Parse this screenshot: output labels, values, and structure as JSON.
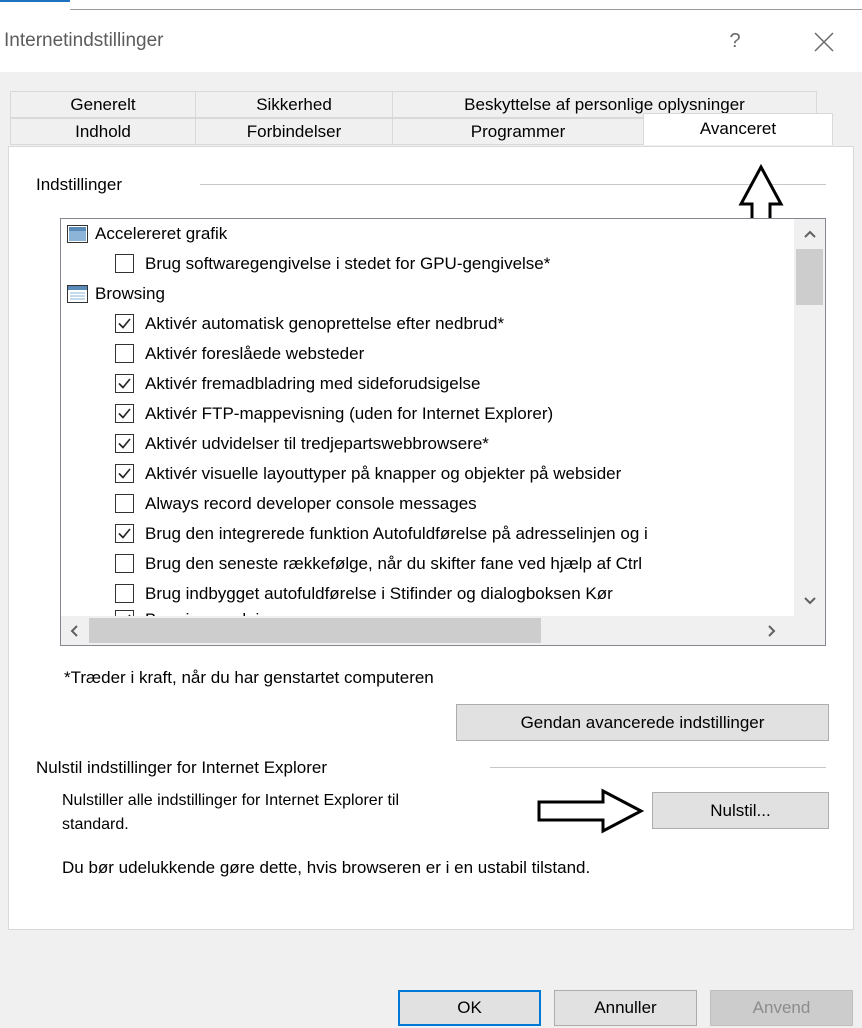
{
  "window": {
    "title": "Internetindstillinger",
    "help_glyph": "?"
  },
  "tabs": {
    "row1": [
      {
        "label": "Generelt"
      },
      {
        "label": "Sikkerhed"
      },
      {
        "label": "Beskyttelse af personlige oplysninger"
      }
    ],
    "row2": [
      {
        "label": "Indhold"
      },
      {
        "label": "Forbindelser"
      },
      {
        "label": "Programmer"
      },
      {
        "label": "Avanceret",
        "active": true
      }
    ]
  },
  "settings": {
    "group_label": "Indstillinger",
    "items": [
      {
        "kind": "category",
        "label": "Accelereret grafik",
        "icon": "display-category-icon"
      },
      {
        "kind": "checkbox",
        "checked": false,
        "label": "Brug softwaregengivelse i stedet for GPU-gengivelse*"
      },
      {
        "kind": "category",
        "label": "Browsing",
        "icon": "window-category-icon"
      },
      {
        "kind": "checkbox",
        "checked": true,
        "label": "Aktivér automatisk genoprettelse efter nedbrud*"
      },
      {
        "kind": "checkbox",
        "checked": false,
        "label": "Aktivér foreslåede websteder"
      },
      {
        "kind": "checkbox",
        "checked": true,
        "label": "Aktivér fremadbladring med sideforudsigelse"
      },
      {
        "kind": "checkbox",
        "checked": true,
        "label": "Aktivér FTP-mappevisning (uden for Internet Explorer)"
      },
      {
        "kind": "checkbox",
        "checked": true,
        "label": "Aktivér udvidelser til tredjepartswebbrowsere*"
      },
      {
        "kind": "checkbox",
        "checked": true,
        "label": "Aktivér visuelle layouttyper på knapper og objekter på websider"
      },
      {
        "kind": "checkbox",
        "checked": false,
        "label": "Always record developer console messages"
      },
      {
        "kind": "checkbox",
        "checked": true,
        "label": "Brug den integrerede funktion Autofuldførelse på adresselinjen og i"
      },
      {
        "kind": "checkbox",
        "checked": false,
        "label": "Brug den seneste rækkefølge, når du skifter fane ved hjælp af Ctrl"
      },
      {
        "kind": "checkbox",
        "checked": false,
        "label": "Brug indbygget autofuldførelse i Stifinder og dialogboksen Kør"
      },
      {
        "kind": "checkbox",
        "checked": true,
        "label": "Brug jævn rulning"
      }
    ],
    "restart_note": "*Træder i kraft, når du har genstartet computeren",
    "restore_button": "Gendan avancerede indstillinger"
  },
  "reset": {
    "group_label": "Nulstil indstillinger for Internet Explorer",
    "desc_line1": "Nulstiller alle indstillinger for Internet Explorer til",
    "desc_line2": "standard.",
    "button": "Nulstil...",
    "warning": "Du bør udelukkende gøre dette, hvis browseren er i en ustabil tilstand."
  },
  "footer": {
    "ok": "OK",
    "cancel": "Annuller",
    "apply": "Anvend"
  },
  "colors": {
    "title_text": "#5c5c5c",
    "accent": "#1e73be",
    "disabled_text": "#8c8c8c"
  }
}
